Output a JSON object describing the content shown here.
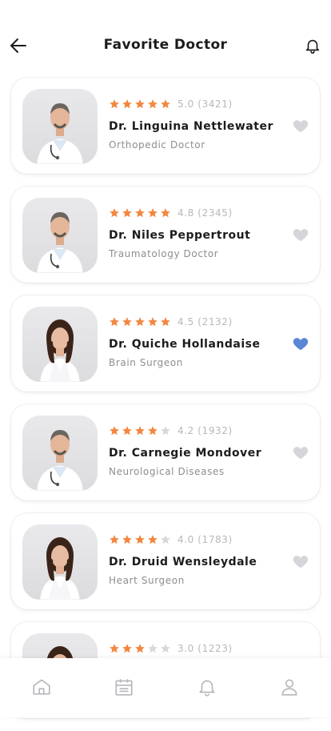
{
  "header": {
    "title": "Favorite Doctor",
    "back_icon": "arrow-left-icon",
    "notification_icon": "bell-icon"
  },
  "colors": {
    "star_filled": "#f3873f",
    "star_empty": "#d8d8dc",
    "favorite_active": "#5a86d6",
    "favorite_inactive": "#d6d6da"
  },
  "doctors": [
    {
      "name": "Dr. Linguina Nettlewater",
      "specialty": "Orthopedic Doctor",
      "rating_text": "5.0 (3421)",
      "stars_filled": 5,
      "favorite": false,
      "gender": "male"
    },
    {
      "name": "Dr. Niles Peppertrout",
      "specialty": "Traumatology Doctor",
      "rating_text": "4.8 (2345)",
      "stars_filled": 5,
      "favorite": false,
      "gender": "male"
    },
    {
      "name": "Dr. Quiche Hollandaise",
      "specialty": "Brain Surgeon",
      "rating_text": "4.5 (2132)",
      "stars_filled": 5,
      "favorite": true,
      "gender": "female"
    },
    {
      "name": "Dr. Carnegie Mondover",
      "specialty": "Neurological Diseases",
      "rating_text": "4.2 (1932)",
      "stars_filled": 4,
      "favorite": false,
      "gender": "male"
    },
    {
      "name": "Dr. Druid Wensleydale",
      "specialty": "Heart Surgeon",
      "rating_text": "4.0 (1783)",
      "stars_filled": 4,
      "favorite": false,
      "gender": "female"
    },
    {
      "name": "",
      "specialty": "",
      "rating_text": "3.0 (1223)",
      "stars_filled": 3,
      "favorite": false,
      "gender": "female"
    }
  ],
  "tabbar": {
    "items": [
      {
        "icon": "home-icon"
      },
      {
        "icon": "calendar-icon"
      },
      {
        "icon": "bell-icon"
      },
      {
        "icon": "user-icon"
      }
    ]
  }
}
